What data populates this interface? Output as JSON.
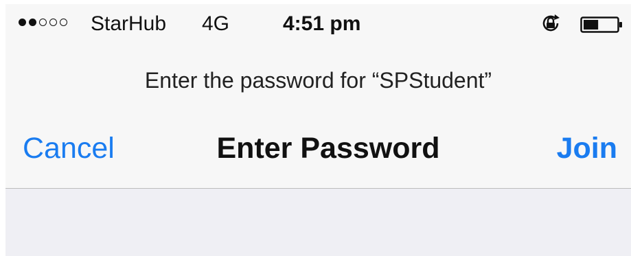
{
  "status_bar": {
    "signal_filled": 2,
    "signal_empty": 3,
    "carrier": "StarHub",
    "network": "4G",
    "time": "4:51 pm",
    "rotation_lock_icon": "rotation-lock-icon",
    "battery_icon": "battery-icon",
    "battery_level": 0.45
  },
  "prompt": {
    "text": "Enter the password for “SPStudent”"
  },
  "nav": {
    "cancel": "Cancel",
    "title": "Enter Password",
    "join": "Join"
  },
  "colors": {
    "accent": "#1a7cf0",
    "background": "#f7f7f7",
    "content_background": "#efeff4",
    "text": "#111111"
  }
}
